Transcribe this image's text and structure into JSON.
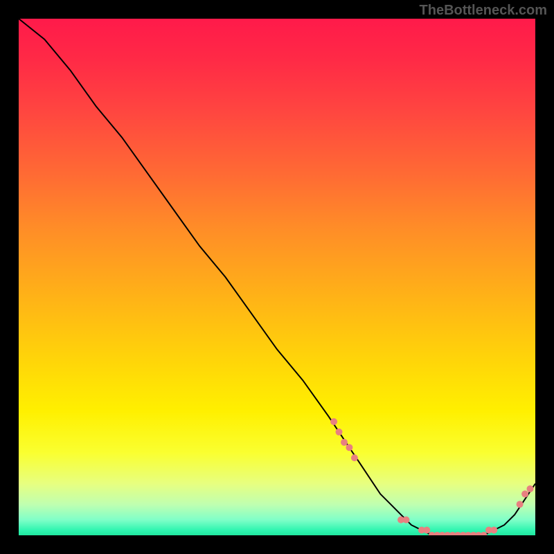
{
  "watermark": "TheBottleneck.com",
  "chart_data": {
    "type": "line",
    "title": "",
    "xlabel": "",
    "ylabel": "",
    "xlim": [
      0,
      100
    ],
    "ylim": [
      0,
      100
    ],
    "grid": false,
    "background_gradient": {
      "top": "#ff1a4a",
      "mid": "#ffd200",
      "bottom": "#20e8a0"
    },
    "line_color": "#000000",
    "marker_color": "#e88080",
    "x": [
      0,
      5,
      10,
      15,
      20,
      25,
      30,
      35,
      40,
      45,
      50,
      55,
      60,
      62,
      64,
      66,
      68,
      70,
      72,
      74,
      76,
      78,
      80,
      82,
      84,
      86,
      88,
      90,
      92,
      94,
      96,
      98,
      100
    ],
    "y": [
      100,
      96,
      90,
      83,
      77,
      70,
      63,
      56,
      50,
      43,
      36,
      30,
      23,
      20,
      17,
      14,
      11,
      8,
      6,
      4,
      2,
      1,
      0,
      0,
      0,
      0,
      0,
      0,
      1,
      2,
      4,
      7,
      10
    ],
    "markers": {
      "x": [
        61,
        62,
        63,
        64,
        65,
        74,
        75,
        78,
        79,
        80,
        81,
        82,
        83,
        84,
        85,
        86,
        87,
        88,
        89,
        90,
        91,
        92,
        97,
        98,
        99
      ],
      "y": [
        22,
        20,
        18,
        17,
        15,
        3,
        3,
        1,
        1,
        0,
        0,
        0,
        0,
        0,
        0,
        0,
        0,
        0,
        0,
        0,
        1,
        1,
        6,
        8,
        9
      ]
    }
  }
}
